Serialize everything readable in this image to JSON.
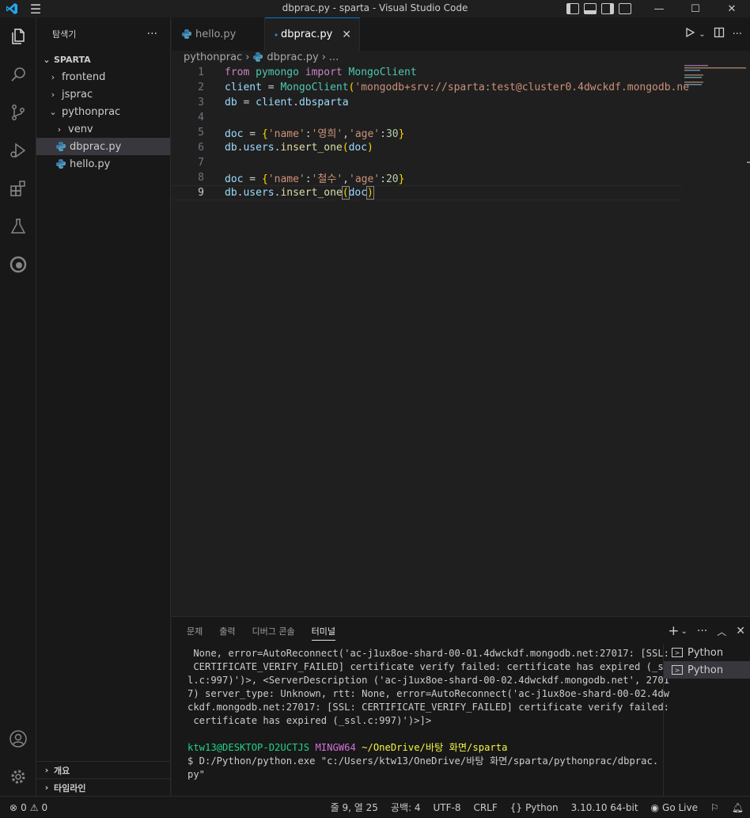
{
  "window": {
    "title": "dbprac.py - sparta - Visual Studio Code"
  },
  "sidebar": {
    "title": "탐색기",
    "more": "···",
    "root": "SPARTA",
    "items": [
      {
        "label": "frontend"
      },
      {
        "label": "jsprac"
      },
      {
        "label": "pythonprac"
      },
      {
        "label": "venv"
      },
      {
        "label": "dbprac.py"
      },
      {
        "label": "hello.py"
      }
    ],
    "outline": "개요",
    "timeline": "타임라인"
  },
  "tabs": [
    {
      "label": "hello.py"
    },
    {
      "label": "dbprac.py",
      "close": "✕"
    }
  ],
  "breadcrumb": {
    "folder": "pythonprac",
    "file": "dbprac.py",
    "more": "..."
  },
  "editor": {
    "line_numbers": [
      "1",
      "2",
      "3",
      "4",
      "5",
      "6",
      "7",
      "8",
      "9"
    ],
    "lines": [
      {
        "t1": "from",
        "t2": " pymongo ",
        "t3": "import",
        "t4": " MongoClient"
      },
      {
        "t1": "client",
        "t2": " = ",
        "t3": "MongoClient",
        "t4": "(",
        "t5": "'mongodb+srv://sparta:test@cluster0.4dwckdf.mongodb.ne"
      },
      {
        "t1": "db",
        "t2": " = ",
        "t3": "client",
        "t4": ".",
        "t5": "dbsparta"
      },
      {},
      {
        "t1": "doc",
        "t2": " = ",
        "t3": "{",
        "t4": "'name'",
        "t5": ":",
        "t6": "'영희'",
        "t7": ",",
        "t8": "'age'",
        "t9": ":",
        "t10": "30",
        "t11": "}"
      },
      {
        "t1": "db",
        "t2": ".",
        "t3": "users",
        "t4": ".",
        "t5": "insert_one",
        "t6": "(",
        "t7": "doc",
        "t8": ")"
      },
      {},
      {
        "t1": "doc",
        "t2": " = ",
        "t3": "{",
        "t4": "'name'",
        "t5": ":",
        "t6": "'철수'",
        "t7": ",",
        "t8": "'age'",
        "t9": ":",
        "t10": "20",
        "t11": "}"
      },
      {
        "t1": "db",
        "t2": ".",
        "t3": "users",
        "t4": ".",
        "t5": "insert_one",
        "t6": "(",
        "t7": "doc",
        "t8": ")"
      }
    ]
  },
  "panel": {
    "tabs": [
      "문제",
      "출력",
      "디버그 콘솔",
      "터미널"
    ],
    "terminal_output": [
      " None, error=AutoReconnect('ac-j1ux8oe-shard-00-01.4dwckdf.mongodb.net:27017: [SSL:",
      " CERTIFICATE_VERIFY_FAILED] certificate verify failed: certificate has expired (_ss",
      "l.c:997)')>, <ServerDescription ('ac-j1ux8oe-shard-00-02.4dwckdf.mongodb.net', 2701",
      "7) server_type: Unknown, rtt: None, error=AutoReconnect('ac-j1ux8oe-shard-00-02.4dw",
      "ckdf.mongodb.net:27017: [SSL: CERTIFICATE_VERIFY_FAILED] certificate verify failed:",
      " certificate has expired (_ssl.c:997)')>]>"
    ],
    "prompt_user": "ktw13@DESKTOP-D2UCTJS",
    "prompt_shell": "MINGW64",
    "prompt_path": "~/OneDrive/바탕 화면/sparta",
    "command_line1": "$ D:/Python/python.exe \"c:/Users/ktw13/OneDrive/바탕 화면/sparta/pythonprac/dbprac.",
    "command_line2": "py\"",
    "terminals": [
      "Python",
      "Python"
    ]
  },
  "status": {
    "errors": "0",
    "warnings": "0",
    "position": "줄 9, 열 25",
    "spaces": "공백: 4",
    "encoding": "UTF-8",
    "eol": "CRLF",
    "language": "Python",
    "interpreter": "3.10.10 64-bit",
    "golive": "Go Live"
  },
  "colors": {
    "accent": "#0078d4",
    "keyword": "#c586c0",
    "string": "#ce9178",
    "function": "#dcdcaa",
    "variable": "#9cdcfe",
    "class": "#4ec9b0"
  }
}
